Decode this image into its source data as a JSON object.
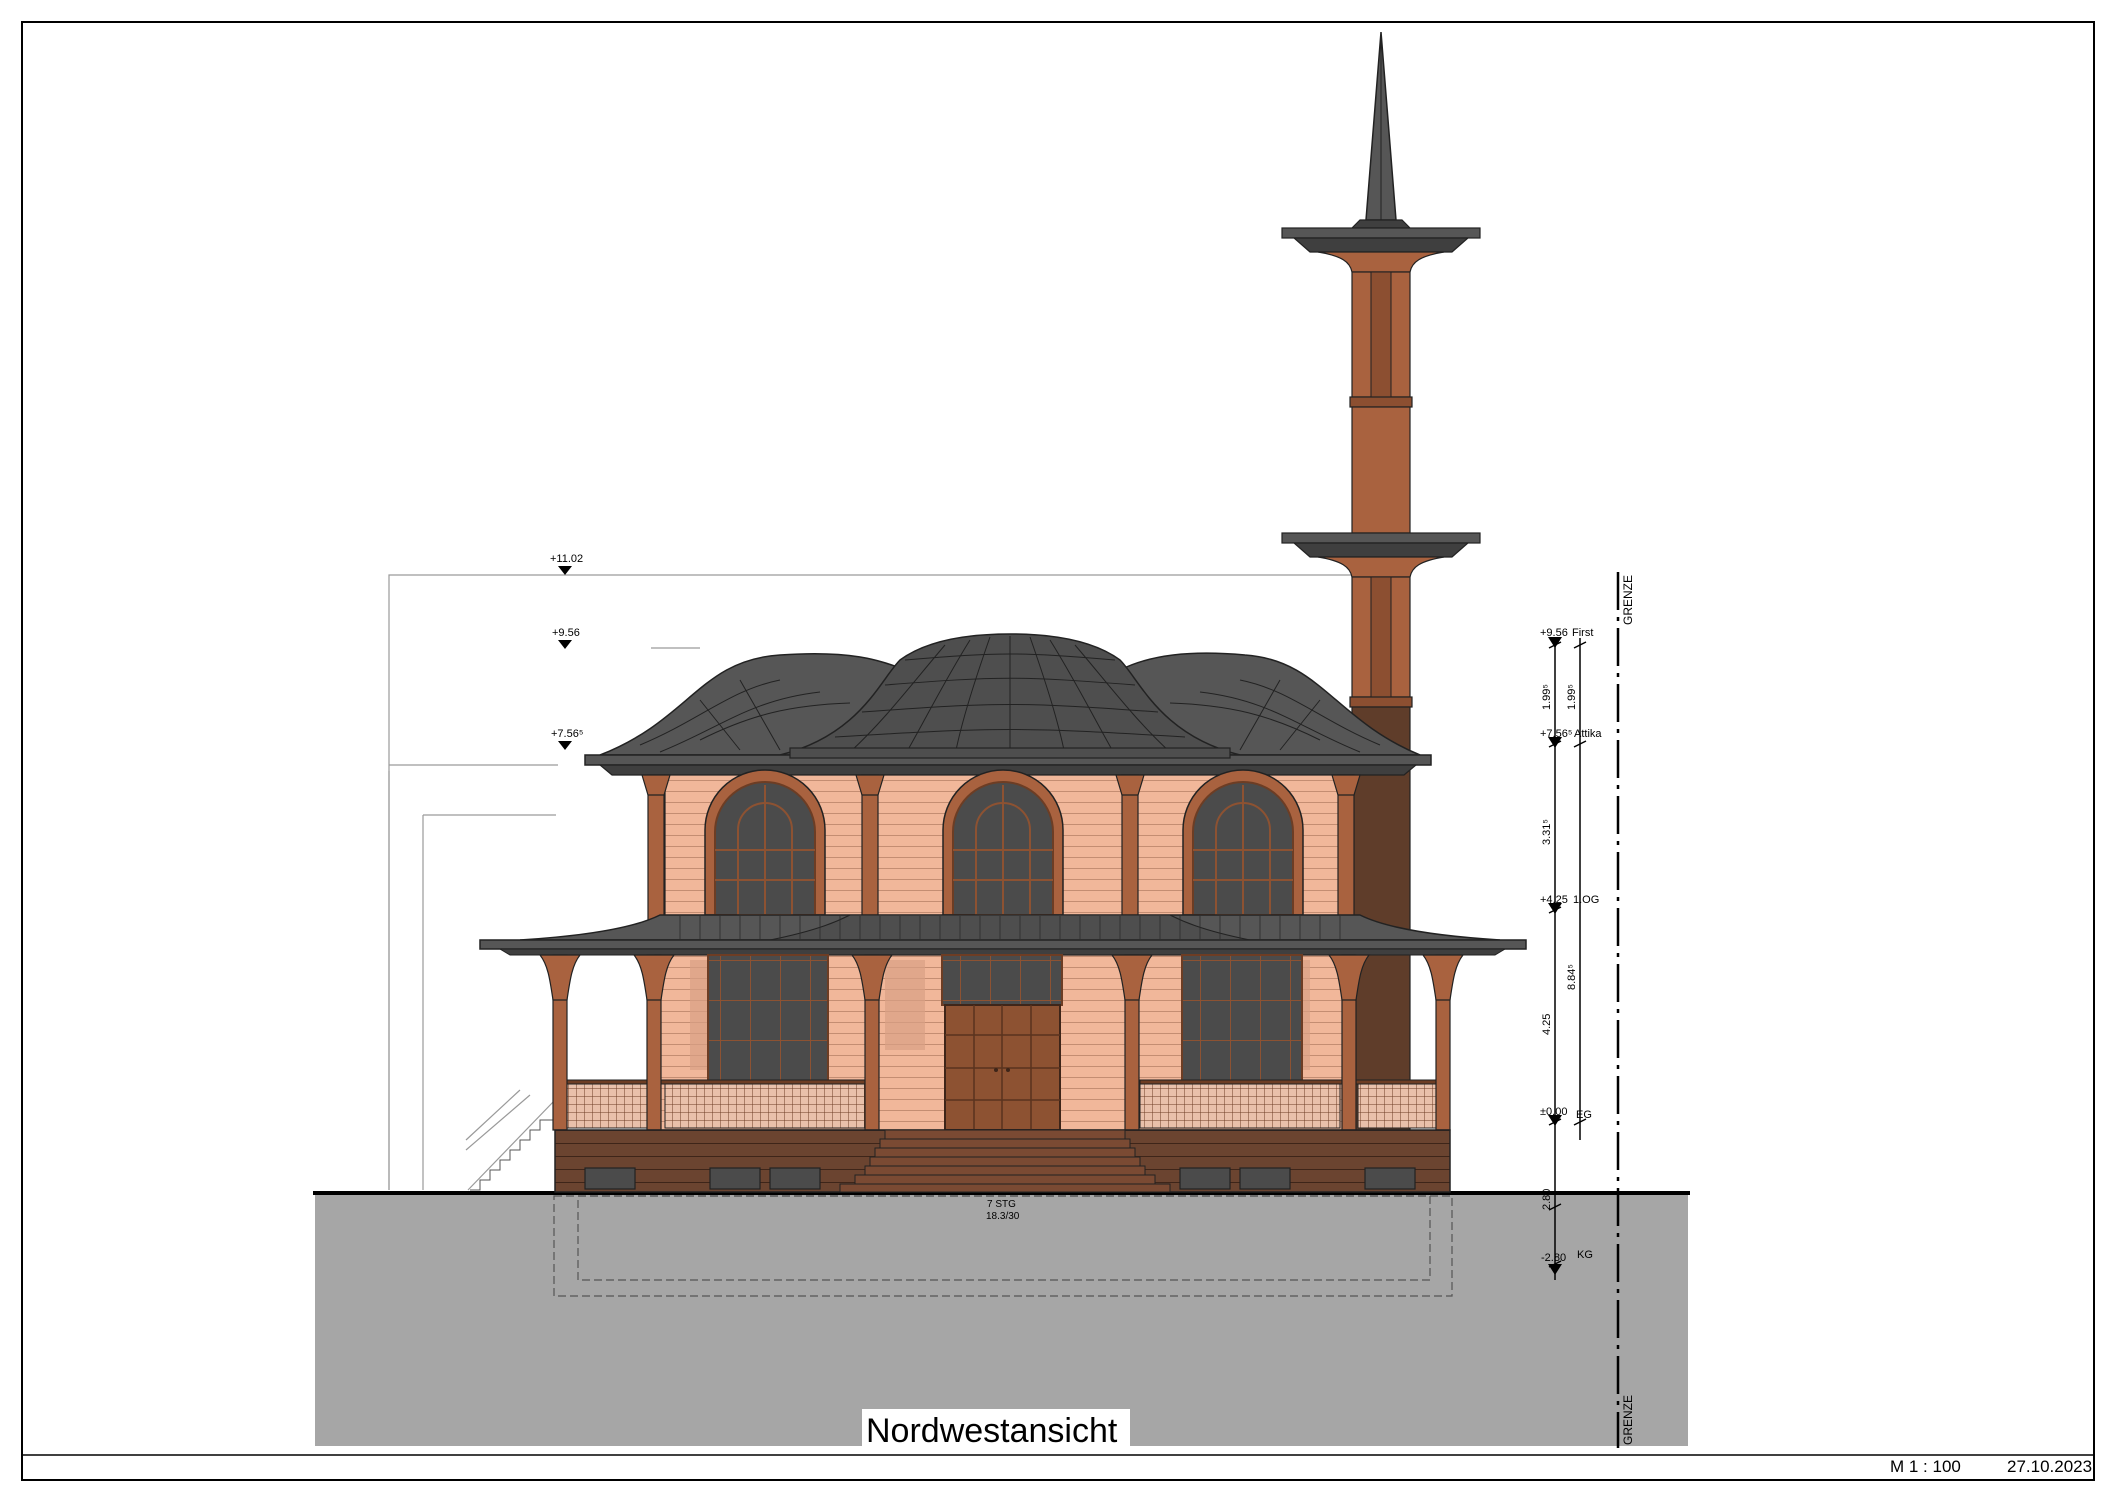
{
  "drawing": {
    "title": "Nordwestansicht",
    "scale": "M  1 : 100",
    "date": "27.10.2023"
  },
  "levels_left": {
    "top": "+11.02",
    "first": "+9.56",
    "attika": "+7.56⁵"
  },
  "levels_right": [
    {
      "value": "+9.56",
      "label": "First"
    },
    {
      "value": "+7.56⁵",
      "label": "Attika"
    },
    {
      "value": "+4.25",
      "label": "1.OG"
    },
    {
      "value": "±0.00",
      "label": "EG"
    },
    {
      "value": "-2.80",
      "label": "KG"
    }
  ],
  "dimensions": {
    "chain_a": [
      "1.99⁵",
      "3.31⁵",
      "4.25",
      "2.80"
    ],
    "chain_b": [
      "1.99⁵",
      "8.84⁵"
    ]
  },
  "boundary": {
    "label": "GRENZE"
  },
  "stairs": {
    "count": "7 STG",
    "ratio": "18.3/30"
  },
  "colors": {
    "roof": "#565656",
    "roof_dark": "#3f3f3f",
    "wall": "#f1b79a",
    "wall_line": "#b9836a",
    "wood": "#a9623f",
    "wood_dark": "#6d3d24",
    "window": "#4b4b4b",
    "base": "#6b4430",
    "ground": "#a6a6a6",
    "minaret_shadow": "#5f3d2a"
  }
}
